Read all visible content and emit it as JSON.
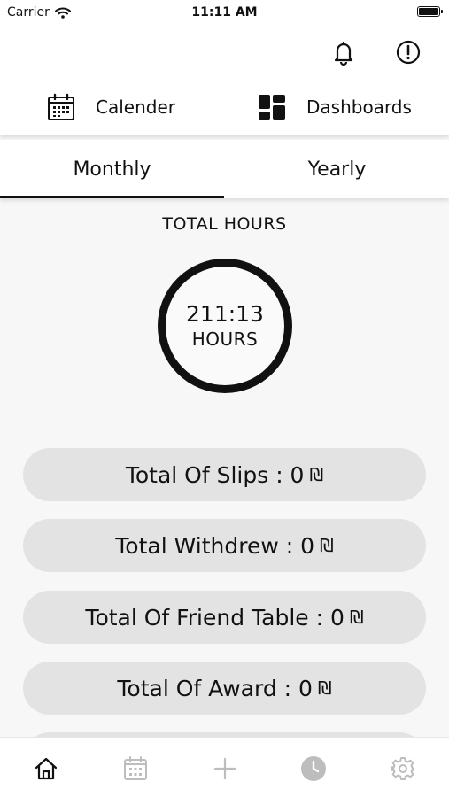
{
  "status_bar": {
    "carrier": "Carrier",
    "time": "11:11 AM"
  },
  "top_bar": {
    "icons": [
      "bell-icon",
      "alert-circle-icon"
    ]
  },
  "main_nav": [
    {
      "label": "Calender",
      "icon": "calendar-icon"
    },
    {
      "label": "Dashboards",
      "icon": "dashboard-icon"
    }
  ],
  "tabs": [
    {
      "label": "Monthly",
      "active": true
    },
    {
      "label": "Yearly",
      "active": false
    }
  ],
  "hours": {
    "title": "TOTAL HOURS",
    "value": "211:13",
    "unit": "HOURS"
  },
  "totals": [
    {
      "label": "Total Of Slips : 0",
      "currency": "₪"
    },
    {
      "label": "Total Withdrew : 0",
      "currency": "₪"
    },
    {
      "label": "Total Of Friend Table : 0",
      "currency": "₪"
    },
    {
      "label": "Total Of Award : 0",
      "currency": "₪"
    }
  ],
  "tab_bar": [
    "home-icon",
    "calendar-icon",
    "plus-icon",
    "clock-icon",
    "settings-icon"
  ],
  "colors": {
    "accent": "#111111",
    "pill_bg": "#e3e3e3",
    "inactive_icon": "#bdbdbd",
    "background": "#f7f7f7"
  }
}
